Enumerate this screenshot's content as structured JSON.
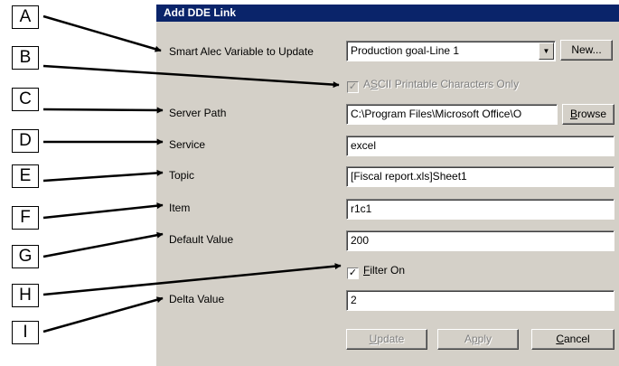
{
  "callouts": [
    "A",
    "B",
    "C",
    "D",
    "E",
    "F",
    "G",
    "H",
    "I"
  ],
  "dialog": {
    "title": "Add DDE Link",
    "variable": {
      "label": "Smart Alec Variable to Update",
      "value": "Production goal-Line 1",
      "new_button": "New..."
    },
    "ascii_only": {
      "prefix": "A",
      "accel": "S",
      "rest": "CII Printable Characters Only",
      "checked": true,
      "enabled": false
    },
    "server_path": {
      "label": "Server Path",
      "value": "C:\\Program Files\\Microsoft Office\\O",
      "browse_accel": "B",
      "browse_rest": "rowse"
    },
    "service": {
      "label": "Service",
      "value": "excel"
    },
    "topic": {
      "label": "Topic",
      "value": "[Fiscal report.xls]Sheet1"
    },
    "item": {
      "label": "Item",
      "value": "r1c1"
    },
    "default_value": {
      "label": "Default Value",
      "value": "200"
    },
    "filter_on": {
      "accel": "F",
      "rest": "ilter On",
      "checked": true
    },
    "delta_value": {
      "label": "Delta Value",
      "value": "2"
    },
    "buttons": {
      "update_accel": "U",
      "update_rest": "pdate",
      "apply_prefix": "A",
      "apply_accel": "p",
      "apply_rest": "ply",
      "cancel_accel": "C",
      "cancel_rest": "ancel"
    }
  }
}
